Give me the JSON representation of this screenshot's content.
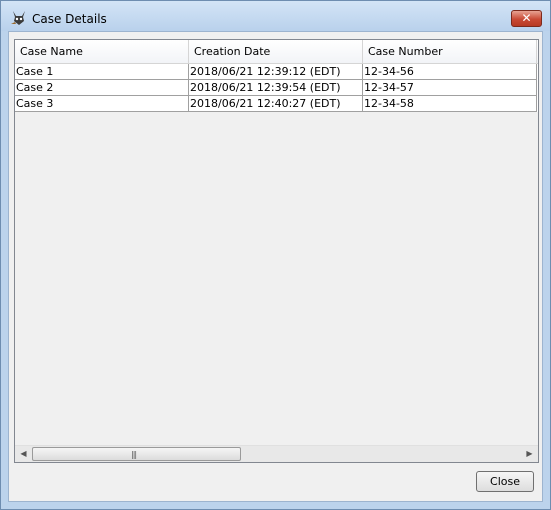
{
  "window": {
    "title": "Case Details",
    "close_glyph": "✕",
    "icon": "spy-dog-icon"
  },
  "table": {
    "columns": [
      "Case Name",
      "Creation Date",
      "Case Number"
    ],
    "rows": [
      [
        "Case 1",
        "2018/06/21 12:39:12 (EDT)",
        "12-34-56"
      ],
      [
        "Case 2",
        "2018/06/21 12:39:54 (EDT)",
        "12-34-57"
      ],
      [
        "Case 3",
        "2018/06/21 12:40:27 (EDT)",
        "12-34-58"
      ]
    ]
  },
  "scrollbar": {
    "left_glyph": "◀",
    "right_glyph": "▶",
    "grip_glyph": "|||"
  },
  "buttons": {
    "close_label": "Close"
  }
}
